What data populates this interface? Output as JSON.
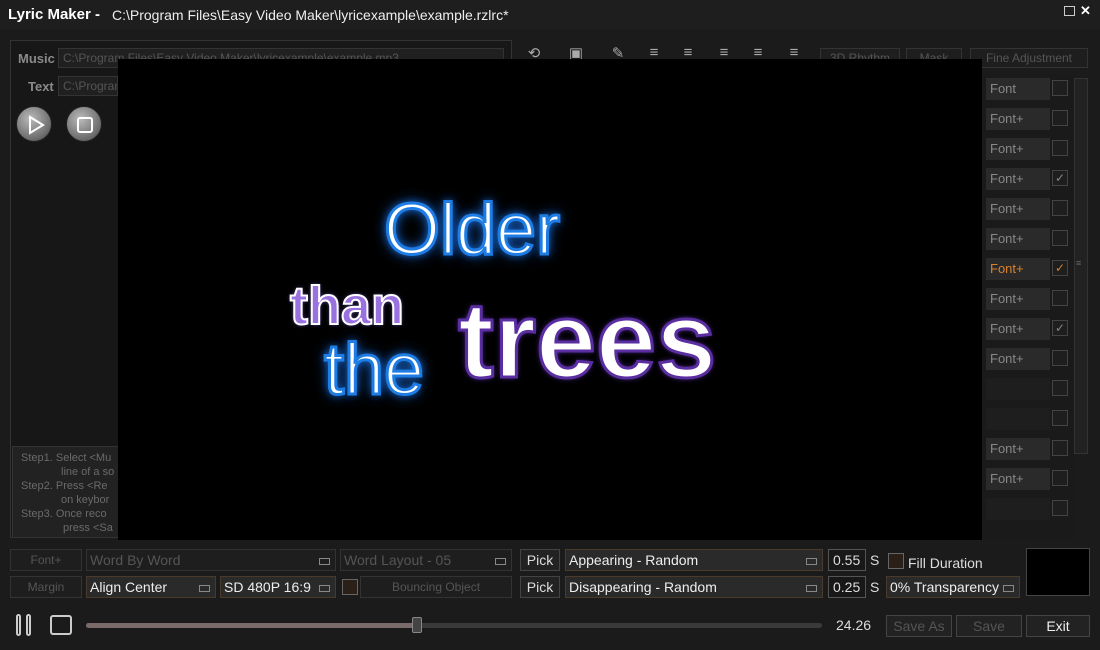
{
  "window": {
    "app_title": "Lyric Maker -",
    "file_path": "C:\\Program Files\\Easy Video Maker\\lyricexample\\example.rzlrc*",
    "restore_glyph": "▫",
    "close_glyph": "✕"
  },
  "left_panel": {
    "music_label": "Music",
    "music_path": "C:\\Program Files\\Easy Video Maker\\lyricexample\\example.mp3",
    "text_label": "Text",
    "text_path": "C:\\Program",
    "steps": [
      "Step1. Select <Mu",
      "line of a so",
      "Step2. Press <Re",
      "on keybor",
      "Step3. Once reco",
      "press <Sa"
    ]
  },
  "top_toolbar": {
    "rhythm_label": "3D Rhythm",
    "mask_label": "Mask",
    "fine_adjustment_label": "Fine Adjustment"
  },
  "preview": {
    "words": [
      "Older",
      "than",
      "the",
      "trees"
    ]
  },
  "right_list": {
    "rows": [
      {
        "label": "Font",
        "checked": false
      },
      {
        "label": "Font+",
        "checked": false
      },
      {
        "label": "Font+",
        "checked": false
      },
      {
        "label": "Font+",
        "checked": true
      },
      {
        "label": "Font+",
        "checked": false
      },
      {
        "label": "Font+",
        "checked": false
      },
      {
        "label": "Font+",
        "checked": true,
        "highlight": "#d9822b"
      },
      {
        "label": "Font+",
        "checked": false
      },
      {
        "label": "Font+",
        "checked": true
      },
      {
        "label": "Font+",
        "checked": false
      },
      {
        "label": "",
        "checked": false
      },
      {
        "label": "",
        "checked": false
      },
      {
        "label": "Font+",
        "checked": false
      },
      {
        "label": "Font+",
        "checked": false
      },
      {
        "label": "",
        "checked": false
      }
    ]
  },
  "bottom": {
    "font_plus_label": "Font+",
    "word_by_word": "Word By Word",
    "word_layout": "Word Layout - 05",
    "margin_label": "Margin",
    "align": "Align Center",
    "resolution": "SD 480P 16:9",
    "bouncing_object": "Bouncing Object",
    "pick_label_1": "Pick",
    "appearing": "Appearing - Random",
    "appear_seconds": "0.55",
    "unit_s": "S",
    "fill_duration_label": "Fill Duration",
    "pick_label_2": "Pick",
    "disappearing": "Disappearing - Random",
    "disappear_seconds": "0.25",
    "transparency": "0% Transparency",
    "swatch_color": "#000000"
  },
  "transport": {
    "time": "24.26",
    "progress_fraction": 0.45,
    "save_as_label": "Save As",
    "save_label": "Save",
    "exit_label": "Exit"
  },
  "colors": {
    "lyric_blue": "#1e7de4",
    "lyric_purple": "#5a2ea0",
    "accent_orange": "#d9822b"
  }
}
